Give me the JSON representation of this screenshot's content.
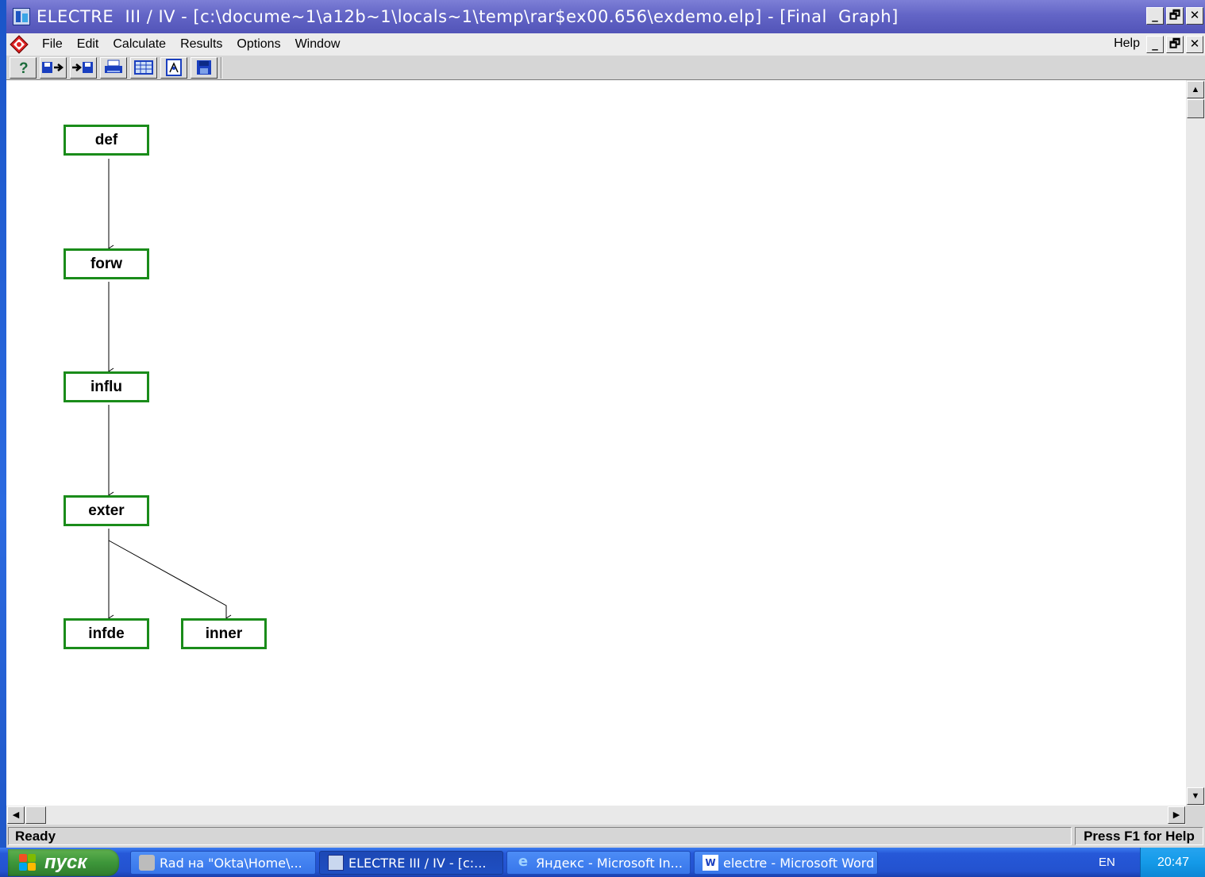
{
  "window": {
    "title": "ELECTRE  III / IV - [c:\\docume~1\\a12b~1\\locals~1\\temp\\rar$ex00.656\\exdemo.elp] - [Final  Graph]",
    "controls": [
      "_",
      "🗗",
      "✕"
    ]
  },
  "menu": {
    "items": [
      "File",
      "Edit",
      "Calculate",
      "Results",
      "Options",
      "Window"
    ],
    "help": "Help"
  },
  "toolbar": {
    "icons": [
      "help-icon",
      "save-export-icon",
      "import-icon",
      "print-icon",
      "table-icon",
      "chart-doc-icon",
      "disk-icon"
    ]
  },
  "graph": {
    "nodes": {
      "def": "def",
      "forw": "forw",
      "influ": "influ",
      "exter": "exter",
      "infde": "infde",
      "inner": "inner"
    },
    "edges": [
      [
        "def",
        "forw"
      ],
      [
        "forw",
        "influ"
      ],
      [
        "influ",
        "exter"
      ],
      [
        "exter",
        "infde"
      ],
      [
        "exter",
        "inner"
      ]
    ],
    "node_color": "#1a8c1a"
  },
  "status": {
    "left": "Ready",
    "right": "Press F1 for Help"
  },
  "taskbar": {
    "start_label": "пуск",
    "tasks": [
      "Rad на \"Okta\\Home\\...",
      "ELECTRE  III / IV - [c:...",
      "Яндекс - Microsoft In...",
      "electre - Microsoft Word"
    ],
    "language": "EN",
    "clock": "20:47"
  }
}
